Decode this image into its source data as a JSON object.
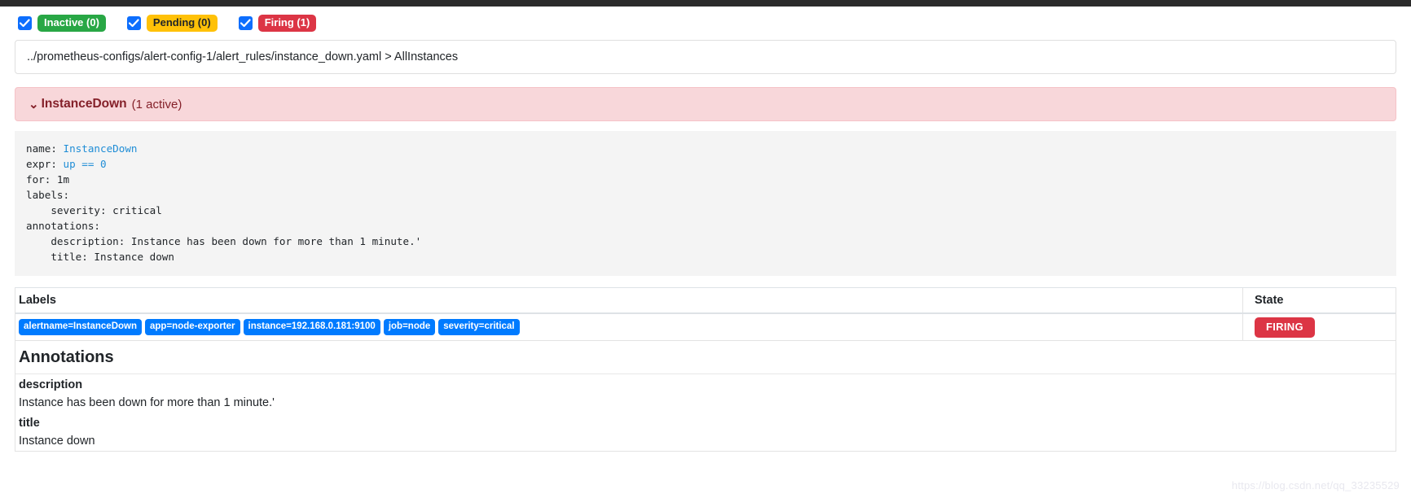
{
  "filters": [
    {
      "name": "inactive",
      "label": "Inactive (0)",
      "checked": true,
      "color": "#28a745",
      "icon": "check-icon"
    },
    {
      "name": "pending",
      "label": "Pending (0)",
      "checked": true,
      "color": "#ffc107",
      "icon": "check-icon"
    },
    {
      "name": "firing",
      "label": "Firing (1)",
      "checked": true,
      "color": "#dc3545",
      "icon": "check-icon"
    }
  ],
  "breadcrumb": {
    "text": "../prometheus-configs/alert-config-1/alert_rules/instance_down.yaml > AllInstances"
  },
  "alert_group": {
    "chevron": "⌄",
    "name": "InstanceDown",
    "active_count": "(1 active)"
  },
  "rule_yaml": {
    "line1_key": "name: ",
    "line1_val": "InstanceDown",
    "line2_key": "expr: ",
    "line2_val": "up == 0",
    "line3": "for: 1m",
    "line4": "labels:",
    "line5": "    severity: critical",
    "line6": "annotations:",
    "line7": "    description: Instance has been down for more than 1 minute.'",
    "line8": "    title: Instance down"
  },
  "labels_table": {
    "headers": {
      "labels": "Labels",
      "state": "State"
    },
    "rows": [
      {
        "labels": [
          "alertname=InstanceDown",
          "app=node-exporter",
          "instance=192.168.0.181:9100",
          "job=node",
          "severity=critical"
        ],
        "state": "FIRING"
      }
    ]
  },
  "annotations": {
    "title": "Annotations",
    "items": [
      {
        "key": "description",
        "value": "Instance has been down for more than 1 minute.'"
      },
      {
        "key": "title",
        "value": "Instance down"
      }
    ]
  },
  "watermark": {
    "text": "https://blog.csdn.net/qq_33235529"
  },
  "colors": {
    "accent_blue": "#007bff",
    "green": "#28a745",
    "amber": "#ffc107",
    "red": "#dc3545",
    "alert_bg": "#f8d7da",
    "code_bg": "#f4f4f4"
  }
}
